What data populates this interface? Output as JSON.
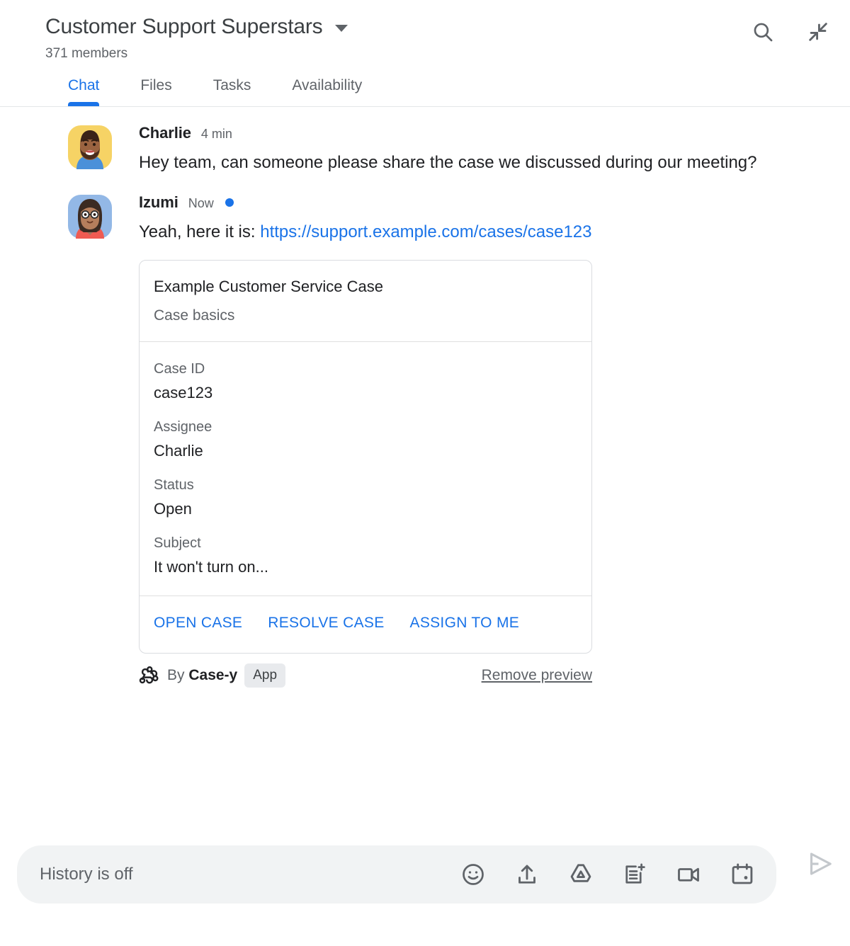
{
  "header": {
    "room_title": "Customer Support Superstars",
    "members": "371 members",
    "caret_icon": "chevron-down-icon",
    "search_icon": "search-icon",
    "collapse_icon": "collapse-icon"
  },
  "tabs": [
    {
      "label": "Chat",
      "active": true
    },
    {
      "label": "Files",
      "active": false
    },
    {
      "label": "Tasks",
      "active": false
    },
    {
      "label": "Availability",
      "active": false
    }
  ],
  "messages": [
    {
      "author": "Charlie",
      "time": "4 min",
      "unread": false,
      "text": "Hey team, can someone please share the case we discussed during our meeting?"
    },
    {
      "author": "Izumi",
      "time": "Now",
      "unread": true,
      "text_prefix": "Yeah, here it is: ",
      "link": "https://support.example.com/cases/case123"
    }
  ],
  "card": {
    "title": "Example Customer Service Case",
    "subtitle": "Case basics",
    "fields": [
      {
        "label": "Case ID",
        "value": "case123"
      },
      {
        "label": "Assignee",
        "value": "Charlie"
      },
      {
        "label": "Status",
        "value": "Open"
      },
      {
        "label": "Subject",
        "value": "It won't turn on..."
      }
    ],
    "actions": [
      "OPEN CASE",
      "RESOLVE CASE",
      "ASSIGN TO ME"
    ],
    "footer": {
      "webhook_icon": "webhook-icon",
      "by_prefix": "By ",
      "app_name": "Case-y",
      "app_badge": "App",
      "remove_preview": "Remove preview"
    }
  },
  "composer": {
    "placeholder": "History is off",
    "icons": [
      "emoji-icon",
      "upload-icon",
      "google-drive-icon",
      "create-document-icon",
      "video-camera-icon",
      "calendar-icon"
    ],
    "send_icon": "send-icon"
  },
  "colors": {
    "accent": "#1a73e8",
    "text_primary": "#202124",
    "text_secondary": "#5f6368",
    "border": "#dadce0",
    "composer_bg": "#f1f3f4",
    "badge_bg": "#e8eaed"
  }
}
